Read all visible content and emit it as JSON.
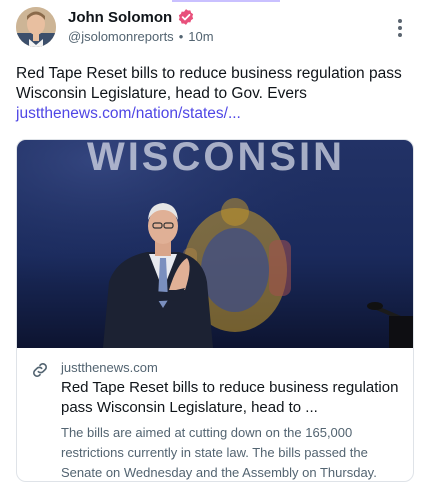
{
  "author": {
    "display_name": "John Solomon",
    "handle": "@jsolomonreports",
    "separator": "•",
    "time_ago": "10m",
    "verified_icon": "verified-badge-icon",
    "verified_color": "#e8507b"
  },
  "post": {
    "text": "Red Tape Reset bills to reduce business regulation pass Wisconsin Legislature, head to Gov. Evers",
    "link_text": "justthenews.com/nation/states/..."
  },
  "card": {
    "image_banner_text": "WISCONSIN",
    "domain": "justthenews.com",
    "title": "Red Tape Reset bills to reduce business regulation pass Wisconsin Legislature, head to ...",
    "description": "The bills are aimed at cutting down on the 165,000 restrictions currently in state law. The bills passed the Senate on Wednesday and the Assembly on Thursday."
  },
  "colors": {
    "link": "#4f46e5",
    "secondary_text": "#536471",
    "card_border": "#dfe3e8"
  }
}
